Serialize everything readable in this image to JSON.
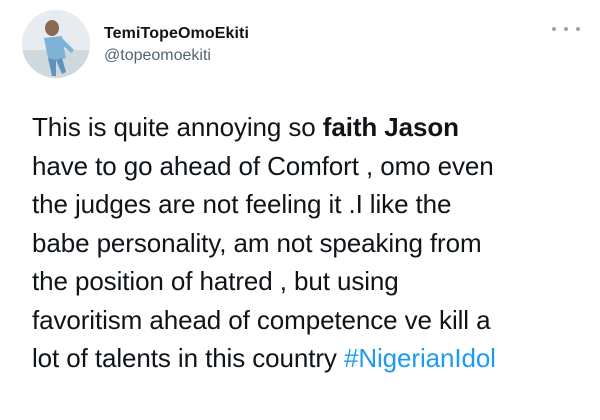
{
  "tweet": {
    "author": {
      "display_name": "TemiTopeOmoEkiti",
      "handle": "@topeomoekiti",
      "avatar_icon": "profile-photo"
    },
    "more_icon": "more-options-icon",
    "colors": {
      "text": "#0f1419",
      "secondary": "#536471",
      "link": "#1d9bf0"
    },
    "text": {
      "line1_pre": "This is quite annoying so ",
      "line1_bold": "faith Jason",
      "line2": "have to go ahead of Comfort , omo even",
      "line3": "the judges are not feeling it .I like the",
      "line4": "babe personality, am not speaking from",
      "line5": "the position of hatred , but using",
      "line6": "favoritism ahead of competence ve kill a",
      "line7_pre": "lot of talents in this country ",
      "hashtag": "#NigerianIdol"
    }
  }
}
